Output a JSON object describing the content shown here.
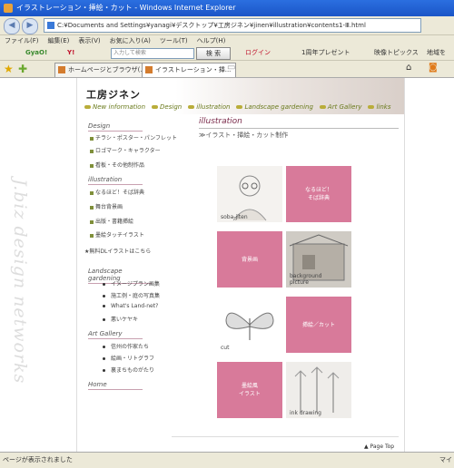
{
  "window": {
    "title": "イラストレーション・挿絵・カット - Windows Internet Explorer"
  },
  "address": {
    "url": "C:¥Documents and Settings¥yanagi¥デスクトップ¥工房ジネン¥jinen¥illustration¥contents1-Ⅲ.html"
  },
  "menu": [
    "ファイル(F)",
    "編集(E)",
    "表示(V)",
    "お気に入り(A)",
    "ツール(T)",
    "ヘルプ(H)"
  ],
  "toolbar": {
    "gyao": "GyaO!",
    "yahoo": "Y!",
    "search_placeholder": "入力して検索",
    "search_button": "検 索",
    "login": "ログイン",
    "anniv": "1周年プレゼント",
    "video": "映像トピックス",
    "map": "地域を"
  },
  "tabs": [
    {
      "label": "ホームページとブラウザ(..."
    },
    {
      "label": "イラストレーション・挿..."
    }
  ],
  "sidebar_vertical_text": "J.biz design networks",
  "site": {
    "logo": "工房ジネン",
    "nav": [
      "New information",
      "Design",
      "illustration",
      "Landscape gardening",
      "Art Gallery",
      "links"
    ],
    "sections": {
      "design": {
        "heading": "Design",
        "links": [
          "チラシ・ポスター・パンフレット",
          "ロゴマーク・キャラクター",
          "看板・その他制作品"
        ]
      },
      "illustration": {
        "heading": "illustration",
        "links": [
          "なるほど！そば辞典",
          "舞台背景画",
          "出版・書籍挿絵",
          "墨絵タッチイラスト"
        ],
        "extra": "★無料DLイラストはこちら"
      },
      "landscape": {
        "heading": "Landscape gardening",
        "links": [
          "イメージプラン画集",
          "施工例・庭の写真集",
          "What's Land-net?",
          "悪いケヤキ"
        ]
      },
      "gallery": {
        "heading": "Art Gallery",
        "links": [
          "信州の作家たち",
          "絵画・リトグラフ",
          "裏まちものがたり"
        ]
      },
      "home": {
        "heading": "Home"
      }
    },
    "page_title": "illustration",
    "page_subtitle": "≫イラスト・挿絵・カット制作",
    "tiles": {
      "soba_img": "soba-jiten",
      "soba_pink": "なるほど！\nそば辞典",
      "haikei_pink": "背景画",
      "bg_img": "background\npicture",
      "cut_img": "cut",
      "sashie_pink": "挿絵／カット",
      "sumi_pink": "墨絵風\nイラスト",
      "ink_img": "ink drawing"
    },
    "page_top": "▲ Page Top"
  },
  "status": {
    "text": "ページが表示されました",
    "zone": "マイ"
  },
  "colors": {
    "titlebar": "#1f5fd0",
    "chrome": "#ece9d8",
    "pink_tile": "#d87a9a",
    "nav_text": "#6a7a1c"
  }
}
